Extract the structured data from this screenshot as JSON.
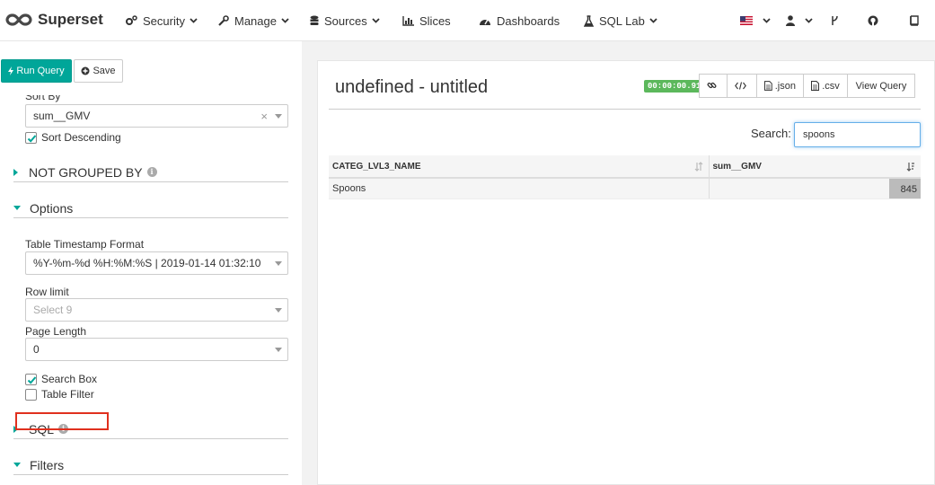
{
  "navbar": {
    "brand": "Superset",
    "items": [
      {
        "label": "Security",
        "icon": "cogs-icon",
        "dropdown": true
      },
      {
        "label": "Manage",
        "icon": "wrench-icon",
        "dropdown": true
      },
      {
        "label": "Sources",
        "icon": "database-icon",
        "dropdown": true
      },
      {
        "label": "Slices",
        "icon": "bar-chart-icon",
        "dropdown": false
      },
      {
        "label": "Dashboards",
        "icon": "dashboard-icon",
        "dropdown": false
      },
      {
        "label": "SQL Lab",
        "icon": "flask-icon",
        "dropdown": true
      }
    ],
    "right_icons": [
      "us-flag-icon",
      "user-icon",
      "code-fork-icon",
      "github-icon",
      "book-icon"
    ]
  },
  "controls": {
    "run_query_label": "Run Query",
    "save_label": "Save",
    "sort_by_label": "Sort By",
    "sort_by_value": "sum__GMV",
    "sort_descending_label": "Sort Descending",
    "sort_descending_checked": true,
    "sections": {
      "not_grouped_by": "NOT GROUPED BY",
      "options": "Options",
      "sql": "SQL",
      "filters": "Filters"
    },
    "timestamp_format_label": "Table Timestamp Format",
    "timestamp_format_value": "%Y-%m-%d %H:%M:%S | 2019-01-14 01:32:10",
    "row_limit_label": "Row limit",
    "row_limit_placeholder": "Select 9",
    "page_length_label": "Page Length",
    "page_length_value": "0",
    "search_box_label": "Search Box",
    "search_box_checked": true,
    "table_filter_label": "Table Filter",
    "table_filter_checked": false
  },
  "slice": {
    "title": "undefined - untitled",
    "timer": "00:00:00.91",
    "toolbar": {
      "json_label": ".json",
      "csv_label": ".csv",
      "view_query_label": "View Query"
    },
    "search_label": "Search:",
    "search_value": "spoons",
    "columns": [
      "CATEG_LVL3_NAME",
      "sum__GMV"
    ],
    "rows": [
      {
        "categ": "Spoons",
        "gmv": "845",
        "gmv_fraction": 1.0
      }
    ]
  },
  "colors": {
    "accent": "#00a699",
    "highlight": "#e0301e",
    "timer": "#5cb85c"
  }
}
